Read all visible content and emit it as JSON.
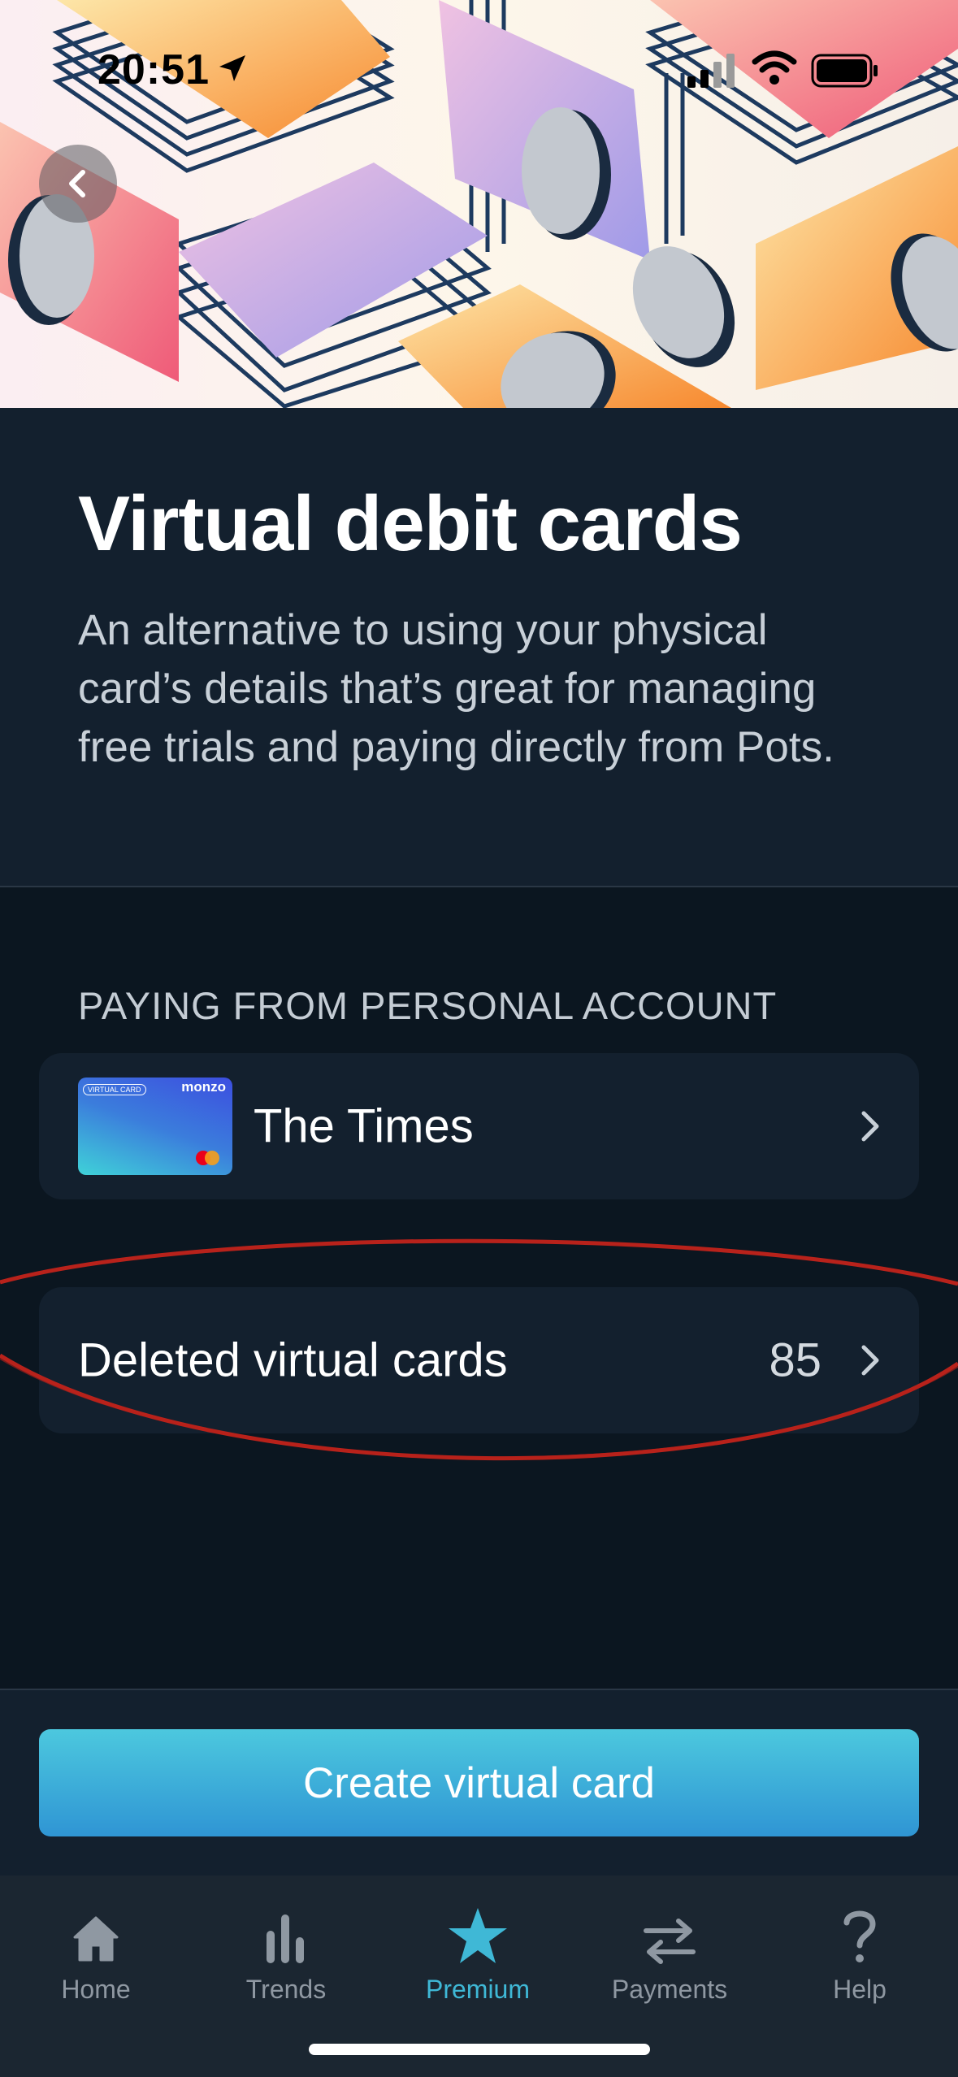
{
  "status_bar": {
    "time": "20:51"
  },
  "header": {
    "title": "Virtual debit cards",
    "description": "An alternative to using your physical card’s details that’s great for managing free trials and paying directly from Pots."
  },
  "section": {
    "label": "PAYING FROM PERSONAL ACCOUNT",
    "card": {
      "name": "The Times",
      "thumb_badge": "VIRTUAL CARD",
      "thumb_brand": "monzo"
    },
    "deleted": {
      "label": "Deleted virtual cards",
      "count": "85"
    }
  },
  "cta": {
    "label": "Create virtual card"
  },
  "tabbar": {
    "items": [
      {
        "label": "Home",
        "icon": "home-icon"
      },
      {
        "label": "Trends",
        "icon": "trends-icon"
      },
      {
        "label": "Premium",
        "icon": "star-icon",
        "active": true
      },
      {
        "label": "Payments",
        "icon": "transfer-arrows-icon"
      },
      {
        "label": "Help",
        "icon": "question-icon"
      }
    ]
  },
  "colors": {
    "background": "#0b1620",
    "panel": "#13202e",
    "accent": "#3fb8d6",
    "annotation": "#b8221b"
  }
}
